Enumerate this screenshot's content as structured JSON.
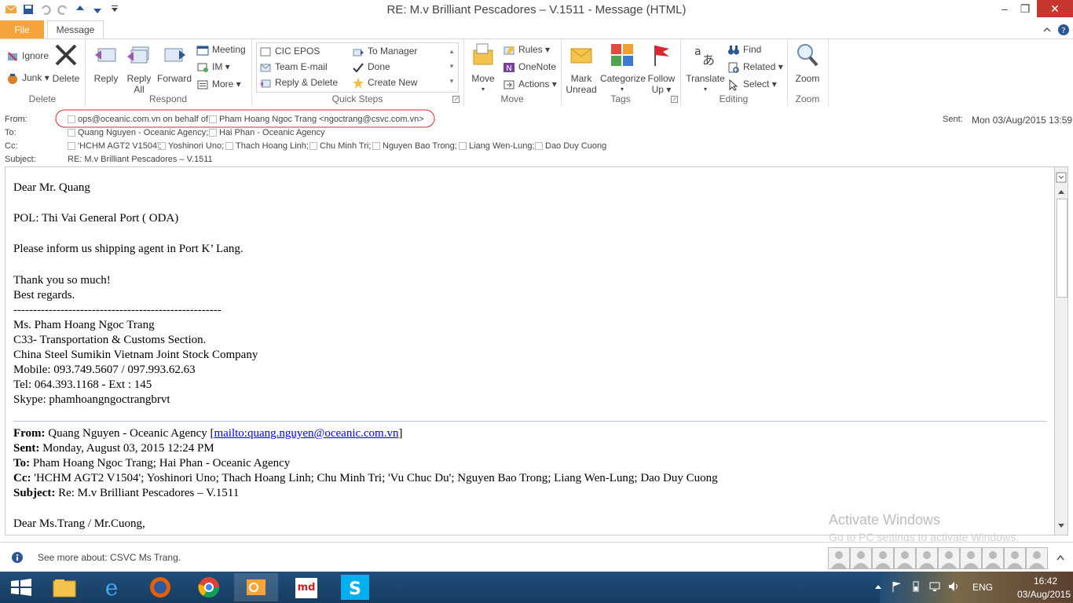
{
  "window": {
    "title": "RE: M.v Brilliant Pescadores – V.1511 -  Message (HTML)",
    "minimize": "–",
    "restore": "❐",
    "close": "✕"
  },
  "tabs": {
    "file": "File",
    "message": "Message"
  },
  "ribbon": {
    "delete_group": {
      "label": "Delete",
      "ignore": "Ignore",
      "junk": "Junk",
      "delete": "Delete"
    },
    "respond_group": {
      "label": "Respond",
      "reply": "Reply",
      "reply_all_1": "Reply",
      "reply_all_2": "All",
      "forward": "Forward",
      "meeting": "Meeting",
      "im": "IM",
      "more": "More"
    },
    "quicksteps_group": {
      "label": "Quick Steps",
      "items": [
        "CIC EPOS",
        "To Manager",
        "Team E-mail",
        "Done",
        "Reply & Delete",
        "Create New"
      ]
    },
    "move_group": {
      "label": "Move",
      "move": "Move",
      "rules": "Rules",
      "onenote": "OneNote",
      "actions": "Actions"
    },
    "tags_group": {
      "label": "Tags",
      "mark_unread_1": "Mark",
      "mark_unread_2": "Unread",
      "categorize": "Categorize",
      "follow_up_1": "Follow",
      "follow_up_2": "Up"
    },
    "editing_group": {
      "label": "Editing",
      "translate": "Translate",
      "find": "Find",
      "related": "Related",
      "select": "Select"
    },
    "zoom_group": {
      "label": "Zoom",
      "zoom": "Zoom"
    }
  },
  "header": {
    "from_label": "From:",
    "from_value": "ops@oceanic.com.vn on behalf of",
    "from_person": "Pham Hoang Ngoc Trang <ngoctrang@csvc.com.vn>",
    "to_label": "To:",
    "to_values": [
      "Quang Nguyen - Oceanic Agency;",
      "Hai Phan - Oceanic Agency"
    ],
    "cc_label": "Cc:",
    "cc_values": [
      "'HCHM AGT2 V1504';",
      "Yoshinori Uno;",
      "Thach Hoang Linh;",
      "Chu Minh Tri;",
      "Nguyen Bao Trong;",
      "Liang Wen-Lung;",
      "Dao Duy Cuong"
    ],
    "subject_label": "Subject:",
    "subject_value": "RE: M.v Brilliant Pescadores – V.1511",
    "sent_label": "Sent:",
    "sent_value": "Mon 03/Aug/2015 13:59"
  },
  "body": {
    "greeting": "Dear Mr. Quang",
    "pol": "POL: Thi Vai General Port ( ODA)",
    "request": "Please inform us shipping agent in Port K’  Lang.",
    "thanks": "Thank you so much!",
    "regards": "Best regards.",
    "rule": "-----------------------------------------------------",
    "sig_name": "Ms. Pham Hoang Ngoc Trang",
    "sig_section": "C33- Transportation & Customs Section.",
    "sig_company": "China Steel Sumikin Vietnam Joint Stock Company",
    "sig_mobile": "Mobile: 093.749.5607 / 097.993.62.63",
    "sig_tel": "Tel: 064.393.1168  - Ext : 145",
    "sig_skype": "Skype: phamhoangngoctrangbrvt",
    "q_from_label": "From:",
    "q_from_value": " Quang Nguyen - Oceanic Agency [",
    "q_from_link": "mailto:quang.nguyen@oceanic.com.vn",
    "q_from_close": "]",
    "q_sent_label": "Sent:",
    "q_sent_value": " Monday, August 03, 2015 12:24 PM",
    "q_to_label": "To:",
    "q_to_value": " Pham Hoang Ngoc Trang; Hai Phan - Oceanic Agency",
    "q_cc_label": "Cc:",
    "q_cc_value": " 'HCHM AGT2 V1504'; Yoshinori Uno; Thach Hoang Linh; Chu Minh Tri; 'Vu Chuc Du'; Nguyen Bao Trong; Liang Wen-Lung; Dao Duy Cuong",
    "q_subject_label": "Subject:",
    "q_subject_value": " Re: M.v Brilliant Pescadores – V.1511",
    "q_greeting": "Dear Ms.Trang / Mr.Cuong,"
  },
  "watermark": {
    "line1": "Activate Windows",
    "line2": "Go to PC settings to activate Windows."
  },
  "people_pane": {
    "text": "See more about: CSVC Ms Trang.",
    "photo_count": 10
  },
  "taskbar": {
    "lang": "ENG",
    "time": "16:42",
    "date": "03/Aug/2015"
  },
  "colors": {
    "file_tab": "#f5a43c",
    "taskbar": "#1f4e7a",
    "link": "#0000ee",
    "highlight_circle": "#d9282f"
  }
}
